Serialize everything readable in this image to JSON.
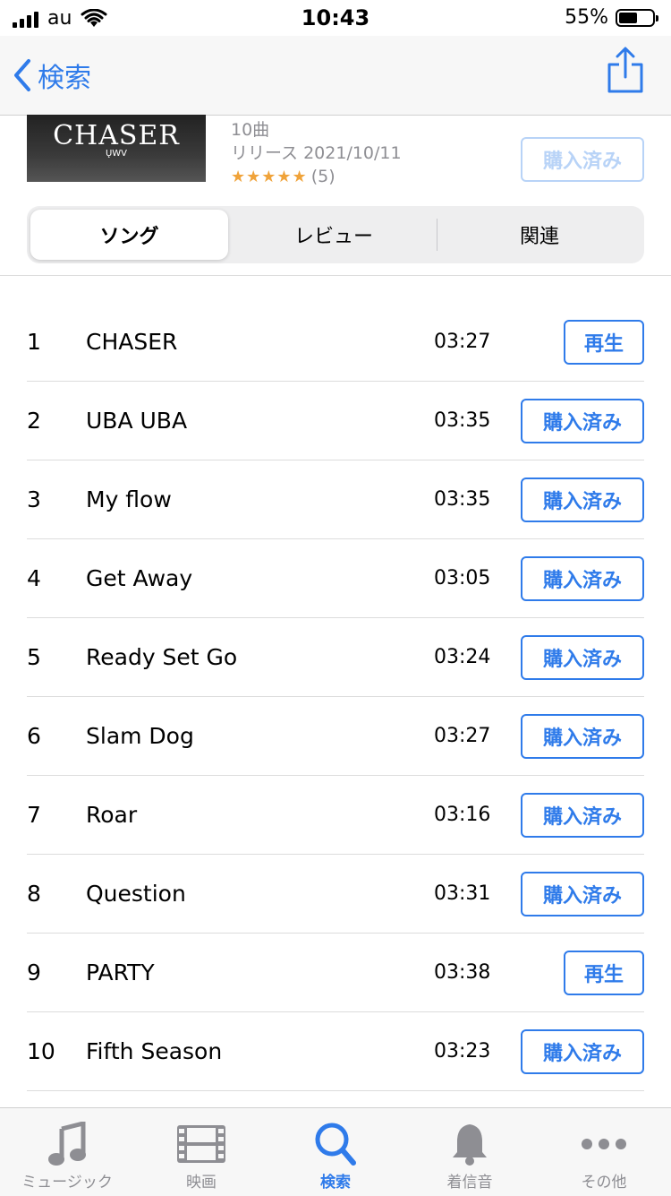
{
  "status": {
    "carrier": "au",
    "time": "10:43",
    "battery": "55%"
  },
  "nav": {
    "back_label": "検索"
  },
  "album": {
    "art_title": "CHASER",
    "art_sub": "ŲWV",
    "track_count": "10曲",
    "release": "リリース 2021/10/11",
    "stars": "★★★★★",
    "rating_count": "(5)",
    "buy_label": "購入済み"
  },
  "tabs_segment": {
    "songs": "ソング",
    "reviews": "レビュー",
    "related": "関連"
  },
  "songs": [
    {
      "num": "1",
      "title": "CHASER",
      "duration": "03:27",
      "action": "再生",
      "type": "play"
    },
    {
      "num": "2",
      "title": "UBA UBA",
      "duration": "03:35",
      "action": "購入済み",
      "type": "buy"
    },
    {
      "num": "3",
      "title": "My flow",
      "duration": "03:35",
      "action": "購入済み",
      "type": "buy"
    },
    {
      "num": "4",
      "title": "Get Away",
      "duration": "03:05",
      "action": "購入済み",
      "type": "buy"
    },
    {
      "num": "5",
      "title": "Ready Set Go",
      "duration": "03:24",
      "action": "購入済み",
      "type": "buy"
    },
    {
      "num": "6",
      "title": "Slam Dog",
      "duration": "03:27",
      "action": "購入済み",
      "type": "buy"
    },
    {
      "num": "7",
      "title": "Roar",
      "duration": "03:16",
      "action": "購入済み",
      "type": "buy"
    },
    {
      "num": "8",
      "title": "Question",
      "duration": "03:31",
      "action": "購入済み",
      "type": "buy"
    },
    {
      "num": "9",
      "title": "PARTY",
      "duration": "03:38",
      "action": "再生",
      "type": "play"
    },
    {
      "num": "10",
      "title": "Fifth Season",
      "duration": "03:23",
      "action": "購入済み",
      "type": "buy"
    }
  ],
  "tabbar": [
    {
      "label": "ミュージック",
      "icon": "music-note-icon"
    },
    {
      "label": "映画",
      "icon": "film-icon"
    },
    {
      "label": "検索",
      "icon": "search-icon"
    },
    {
      "label": "着信音",
      "icon": "bell-icon"
    },
    {
      "label": "その他",
      "icon": "more-icon"
    }
  ],
  "colors": {
    "accent": "#2f7bea",
    "rating": "#f0a33a"
  }
}
